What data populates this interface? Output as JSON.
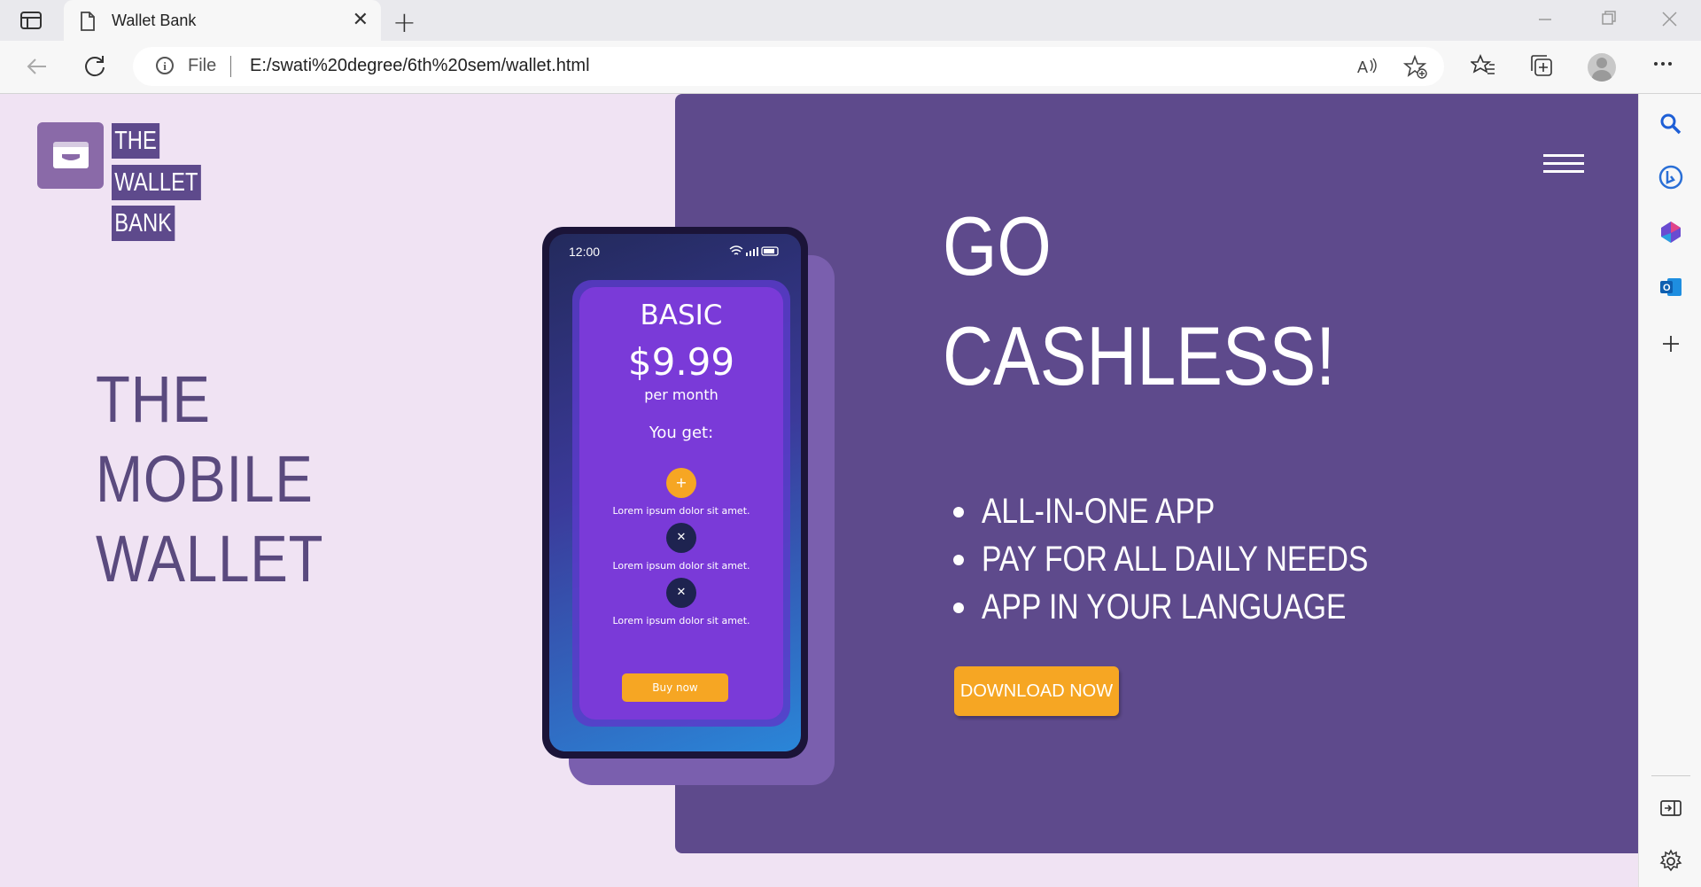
{
  "browser": {
    "tab_title": "Wallet Bank",
    "tab_close": "✕",
    "new_tab": "+",
    "address_scheme": "File",
    "address_path": "E:/swati%20degree/6th%20sem/wallet.html"
  },
  "brand": {
    "logo_words": [
      "THE",
      "WALLET",
      "BANK"
    ]
  },
  "hero": {
    "left_title": [
      "THE",
      "MOBILE",
      "WALLET"
    ],
    "headline": [
      "GO",
      "CASHLESS!"
    ],
    "bullets": [
      "ALL-IN-ONE APP",
      "PAY FOR ALL DAILY NEEDS",
      "APP IN YOUR LANGUAGE"
    ],
    "cta": "DOWNLOAD NOW"
  },
  "phone": {
    "time": "12:00",
    "plan_name": "BASIC",
    "price": "$9.99",
    "period": "per month",
    "you_get": "You get:",
    "features": [
      {
        "icon": "plus-icon",
        "symbol": "+",
        "text": "Lorem ipsum dolor sit amet.",
        "color": "#f6a623"
      },
      {
        "icon": "x-icon",
        "symbol": "✕",
        "text": "Lorem ipsum dolor sit amet.",
        "color": "#1e2350"
      },
      {
        "icon": "x-icon",
        "symbol": "✕",
        "text": "Lorem ipsum dolor sit amet.",
        "color": "#1e2350"
      }
    ],
    "buy_label": "Buy now"
  },
  "colors": {
    "page_bg": "#f0e3f3",
    "panel": "#5e4a8c",
    "accent": "#f6a623",
    "title_text": "#5a4a7e"
  }
}
